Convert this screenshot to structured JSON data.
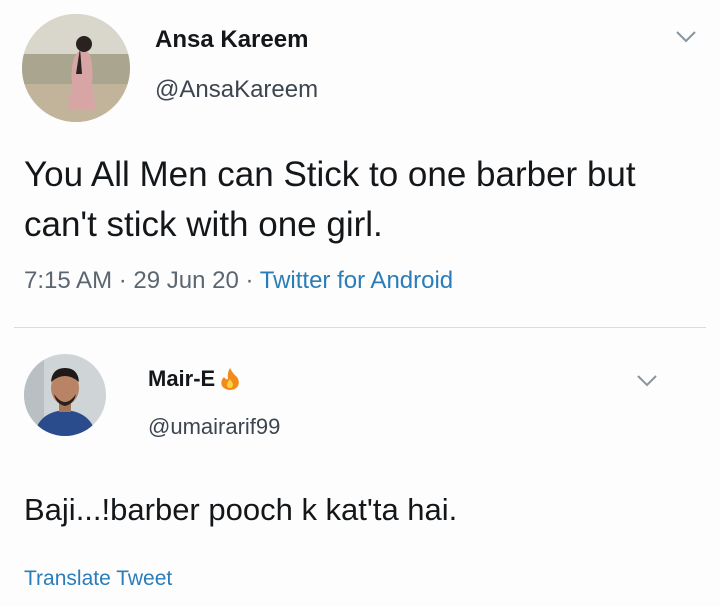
{
  "tweets": [
    {
      "author_name": "Ansa Kareem",
      "author_handle": "@AnsaKareem",
      "text": "You All Men can Stick to one barber but can't stick with one girl.",
      "time": "7:15 AM",
      "date": "29 Jun 20",
      "sep": "·",
      "source": "Twitter for Android",
      "menu_icon": "chevron-down-icon"
    },
    {
      "author_name": "Mair-E",
      "author_handle": "@umairarif99",
      "name_emoji": "fire-icon",
      "text": "Baji...!barber pooch k kat'ta hai.",
      "translate_label": "Translate Tweet",
      "menu_icon": "chevron-down-icon"
    }
  ],
  "colors": {
    "link": "#2a7db8",
    "secondary": "#5b6670",
    "divider": "#d9dde0"
  }
}
